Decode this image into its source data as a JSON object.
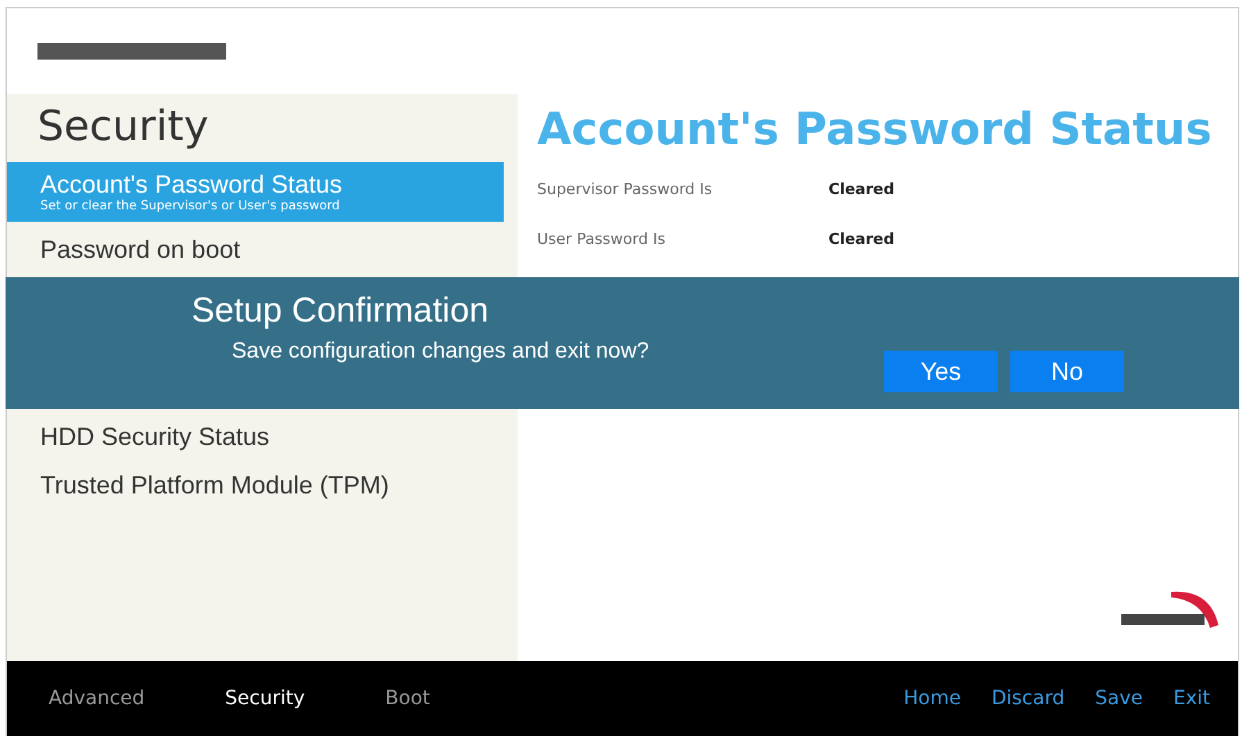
{
  "page_title": "Security",
  "sidebar": {
    "items": [
      {
        "label": "Account's Password Status",
        "subtitle": "Set or clear the Supervisor's or User's password",
        "selected": true
      },
      {
        "label": "Password on boot",
        "selected": false
      },
      {
        "label": "HDD Security Status",
        "selected": false
      },
      {
        "label": "Trusted Platform Module (TPM)",
        "selected": false
      }
    ]
  },
  "content": {
    "title": "Account's Password Status",
    "rows": [
      {
        "label": "Supervisor Password Is",
        "value": "Cleared"
      },
      {
        "label": "User Password Is",
        "value": "Cleared"
      }
    ]
  },
  "dialog": {
    "title": "Setup Confirmation",
    "message": "Save configuration changes and exit now?",
    "buttons": [
      "Yes",
      "No"
    ]
  },
  "footer": {
    "tabs": [
      {
        "label": "Advanced",
        "selected": false
      },
      {
        "label": "Security",
        "selected": true
      },
      {
        "label": "Boot",
        "selected": false
      }
    ],
    "actions": [
      "Home",
      "Discard",
      "Save",
      "Exit"
    ]
  }
}
